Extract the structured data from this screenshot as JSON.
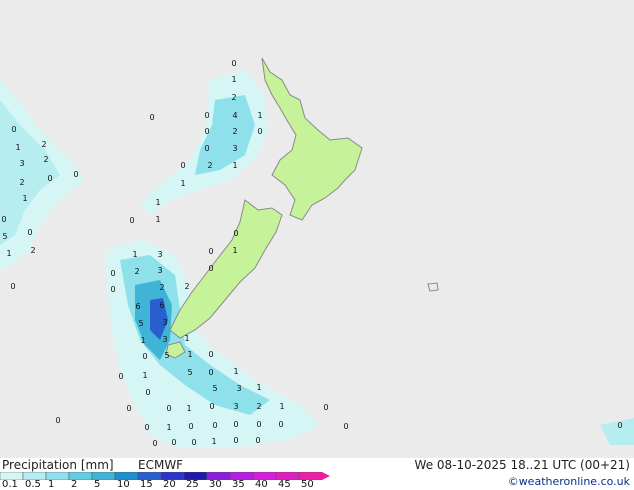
{
  "legend": {
    "title": "Precipitation [mm]",
    "model": "ECMWF",
    "ticks": [
      "0.1",
      "0.5",
      "1",
      "2",
      "5",
      "10",
      "15",
      "20",
      "25",
      "30",
      "35",
      "40",
      "45",
      "50"
    ],
    "colors": [
      "#d6f6f6",
      "#b5edf1",
      "#8ee0ea",
      "#62cce0",
      "#3fb4d6",
      "#1f8fd0",
      "#2a5fcf",
      "#2d35c9",
      "#1f1aa8",
      "#8b1fd8",
      "#b51fe0",
      "#d21fd8",
      "#e01fc0",
      "#ee1fa6"
    ]
  },
  "valid_time": "We 08-10-2025 18..21 UTC (00+21)",
  "credit": "©weatheronline.co.uk",
  "map": {
    "land_color": "#c6f29a",
    "sea_color": "#ebebeb",
    "coast_color": "#8a8a8a"
  },
  "values": [
    "0",
    "1",
    "2",
    "3",
    "4",
    "5",
    "6",
    "8"
  ]
}
